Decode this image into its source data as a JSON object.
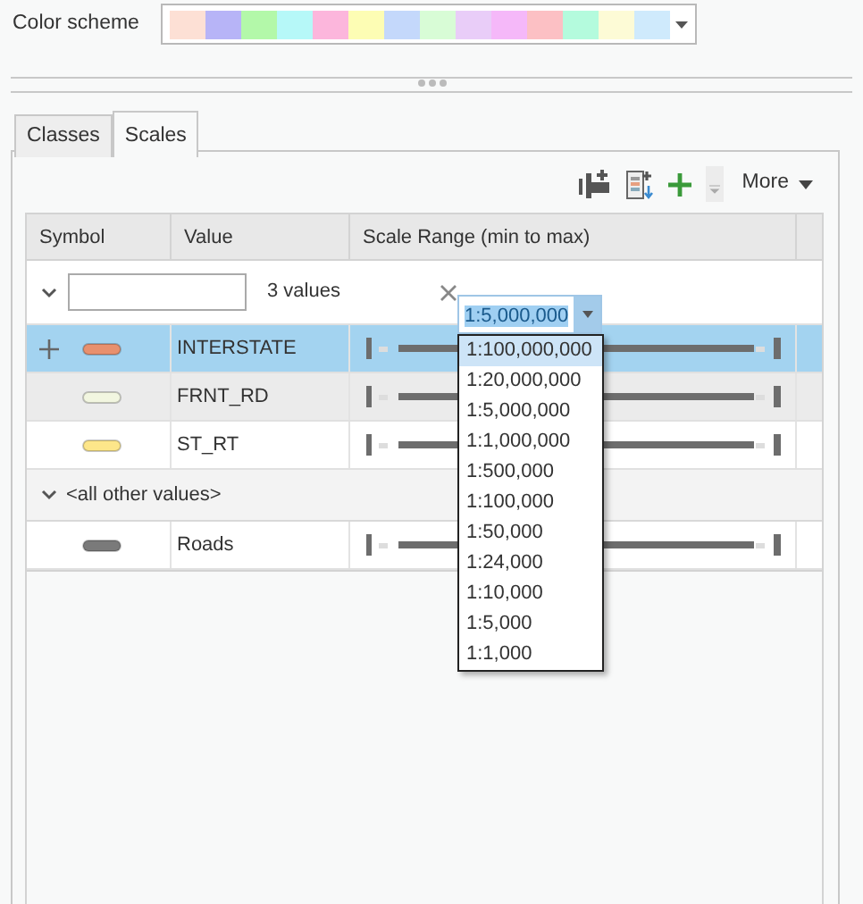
{
  "color_scheme": {
    "label": "Color scheme",
    "swatches": [
      {
        "color": "#fde0d5"
      },
      {
        "color": "#b7b4f7"
      },
      {
        "color": "#b3f8a9"
      },
      {
        "color": "#b6f8f8"
      },
      {
        "color": "#fcb6dc"
      },
      {
        "color": "#fdfdb4"
      },
      {
        "color": "#c4d8fb"
      },
      {
        "color": "#d8fcd6"
      },
      {
        "color": "#e9cdf8"
      },
      {
        "color": "#f5b8f9"
      },
      {
        "color": "#fcc0c4"
      },
      {
        "color": "#b4fbdd"
      },
      {
        "color": "#fdfbd6"
      },
      {
        "color": "#cfeafc"
      }
    ]
  },
  "tabs": [
    {
      "label": "Classes",
      "selected": false
    },
    {
      "label": "Scales",
      "selected": true
    }
  ],
  "toolbar": {
    "more": "More"
  },
  "table": {
    "columns": [
      "Symbol",
      "Value",
      "Scale Range (min to max)"
    ],
    "groups": [
      {
        "kind": "filter",
        "expanded": true,
        "count": "3 values",
        "rows": [
          {
            "value": "INTERSTATE",
            "color": "#e8906e",
            "selected": true,
            "hovered": false
          },
          {
            "value": "FRNT_RD",
            "color": "#f2f6e0",
            "selected": false,
            "hovered": true
          },
          {
            "value": "ST_RT",
            "color": "#fde68a",
            "selected": false,
            "hovered": false
          }
        ]
      },
      {
        "kind": "label",
        "expanded": true,
        "heading": "<all other values>",
        "rows": [
          {
            "value": "Roads",
            "color": "#7a7a7a",
            "selected": false,
            "hovered": false
          }
        ]
      }
    ]
  },
  "scale_combo": {
    "value": "1:5,000,000",
    "expanded": true,
    "options": [
      {
        "label": "1:100,000,000",
        "highlighted": true
      },
      {
        "label": "1:20,000,000",
        "highlighted": false
      },
      {
        "label": "1:5,000,000",
        "highlighted": false
      },
      {
        "label": "1:1,000,000",
        "highlighted": false
      },
      {
        "label": "1:500,000",
        "highlighted": false
      },
      {
        "label": "1:100,000",
        "highlighted": false
      },
      {
        "label": "1:50,000",
        "highlighted": false
      },
      {
        "label": "1:24,000",
        "highlighted": false
      },
      {
        "label": "1:10,000",
        "highlighted": false
      },
      {
        "label": "1:5,000",
        "highlighted": false
      },
      {
        "label": "1:1,000",
        "highlighted": false
      }
    ]
  }
}
